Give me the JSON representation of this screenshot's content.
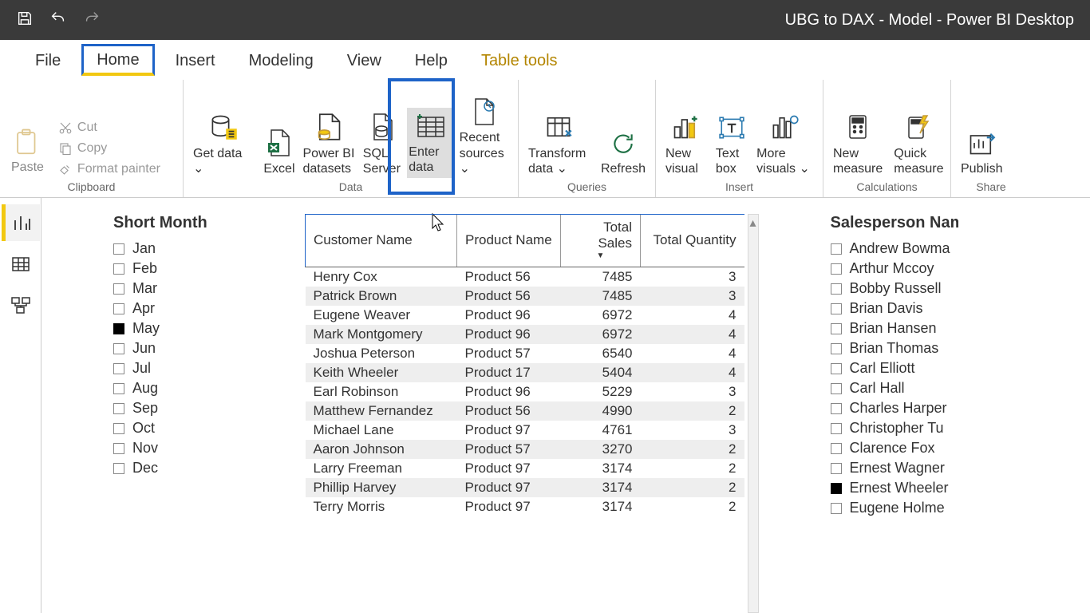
{
  "window": {
    "title": "UBG to DAX - Model - Power BI Desktop"
  },
  "menu": {
    "items": [
      "File",
      "Home",
      "Insert",
      "Modeling",
      "View",
      "Help",
      "Table tools"
    ],
    "active": "Home",
    "context": "Table tools"
  },
  "ribbon": {
    "groups": {
      "clipboard": {
        "label": "Clipboard",
        "paste": "Paste",
        "cut": "Cut",
        "copy": "Copy",
        "format_painter": "Format painter"
      },
      "data": {
        "label": "Data",
        "get_data": "Get data",
        "excel": "Excel",
        "pbi_datasets": "Power BI datasets",
        "sql_server": "SQL Server",
        "enter_data": "Enter data",
        "recent_sources": "Recent sources"
      },
      "queries": {
        "label": "Queries",
        "transform_data": "Transform data",
        "refresh": "Refresh"
      },
      "insert": {
        "label": "Insert",
        "new_visual": "New visual",
        "text_box": "Text box",
        "more_visuals": "More visuals"
      },
      "calculations": {
        "label": "Calculations",
        "new_measure": "New measure",
        "quick_measure": "Quick measure"
      },
      "share": {
        "label": "Share",
        "publish": "Publish"
      }
    }
  },
  "views": {
    "active": "report"
  },
  "slicer_month": {
    "title": "Short Month",
    "items": [
      {
        "label": "Jan",
        "checked": false
      },
      {
        "label": "Feb",
        "checked": false
      },
      {
        "label": "Mar",
        "checked": false
      },
      {
        "label": "Apr",
        "checked": false
      },
      {
        "label": "May",
        "checked": true
      },
      {
        "label": "Jun",
        "checked": false
      },
      {
        "label": "Jul",
        "checked": false
      },
      {
        "label": "Aug",
        "checked": false
      },
      {
        "label": "Sep",
        "checked": false
      },
      {
        "label": "Oct",
        "checked": false
      },
      {
        "label": "Nov",
        "checked": false
      },
      {
        "label": "Dec",
        "checked": false
      }
    ]
  },
  "table": {
    "columns": [
      "Customer Name",
      "Product Name",
      "Total Sales",
      "Total Quantity"
    ],
    "sort_col": "Total Sales",
    "sort_dir": "desc",
    "rows": [
      {
        "customer": "Henry Cox",
        "product": "Product 56",
        "sales": 7485,
        "qty": 3
      },
      {
        "customer": "Patrick Brown",
        "product": "Product 56",
        "sales": 7485,
        "qty": 3
      },
      {
        "customer": "Eugene Weaver",
        "product": "Product 96",
        "sales": 6972,
        "qty": 4
      },
      {
        "customer": "Mark Montgomery",
        "product": "Product 96",
        "sales": 6972,
        "qty": 4
      },
      {
        "customer": "Joshua Peterson",
        "product": "Product 57",
        "sales": 6540,
        "qty": 4
      },
      {
        "customer": "Keith Wheeler",
        "product": "Product 17",
        "sales": 5404,
        "qty": 4
      },
      {
        "customer": "Earl Robinson",
        "product": "Product 96",
        "sales": 5229,
        "qty": 3
      },
      {
        "customer": "Matthew Fernandez",
        "product": "Product 56",
        "sales": 4990,
        "qty": 2
      },
      {
        "customer": "Michael Lane",
        "product": "Product 97",
        "sales": 4761,
        "qty": 3
      },
      {
        "customer": "Aaron Johnson",
        "product": "Product 57",
        "sales": 3270,
        "qty": 2
      },
      {
        "customer": "Larry Freeman",
        "product": "Product 97",
        "sales": 3174,
        "qty": 2
      },
      {
        "customer": "Phillip Harvey",
        "product": "Product 97",
        "sales": 3174,
        "qty": 2
      },
      {
        "customer": "Terry Morris",
        "product": "Product 97",
        "sales": 3174,
        "qty": 2
      }
    ]
  },
  "slicer_sales": {
    "title": "Salesperson Nam",
    "items": [
      {
        "label": "Andrew Bowma",
        "checked": false
      },
      {
        "label": "Arthur Mccoy",
        "checked": false
      },
      {
        "label": "Bobby Russell",
        "checked": false
      },
      {
        "label": "Brian Davis",
        "checked": false
      },
      {
        "label": "Brian Hansen",
        "checked": false
      },
      {
        "label": "Brian Thomas",
        "checked": false
      },
      {
        "label": "Carl Elliott",
        "checked": false
      },
      {
        "label": "Carl Hall",
        "checked": false
      },
      {
        "label": "Charles Harper",
        "checked": false
      },
      {
        "label": "Christopher Tu",
        "checked": false
      },
      {
        "label": "Clarence Fox",
        "checked": false
      },
      {
        "label": "Ernest Wagner",
        "checked": false
      },
      {
        "label": "Ernest Wheeler",
        "checked": true
      },
      {
        "label": "Eugene Holme",
        "checked": false
      }
    ]
  },
  "icons": {
    "dropdown": "⌄"
  }
}
